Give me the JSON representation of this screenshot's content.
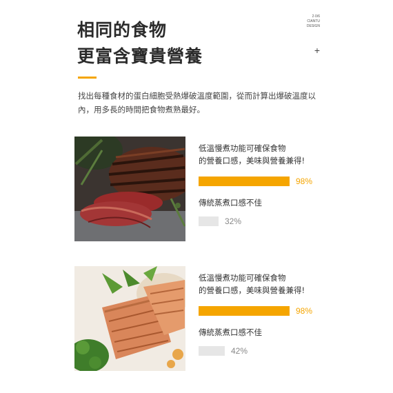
{
  "heading": {
    "line1": "相同的食物",
    "line2": "更富含寶貴營養"
  },
  "brand": {
    "line1": "2·0/6",
    "line2": "CIANTU",
    "line3": "DESIGN",
    "plus": "+"
  },
  "intro": "找出每種食材的蛋白細胞受熱爆破溫度範圍，從而計算出爆破溫度以內，用多長的時間把食物煮熟最好。",
  "colors": {
    "accent": "#f5a500",
    "gray_bar": "#e6e6e6"
  },
  "comparisons": [
    {
      "image": "steak-image",
      "feature_line1": "低溫慢煮功能可確保食物",
      "feature_line2": "的營養口感，美味與營養兼得!",
      "good_pct": "98%",
      "good_value": 0.98,
      "alt_label": "傳統蒸煮口感不佳",
      "bad_pct": "32%",
      "bad_value": 0.32
    },
    {
      "image": "salmon-image",
      "feature_line1": "低溫慢煮功能可確保食物",
      "feature_line2": "的營養口感，美味與營養兼得!",
      "good_pct": "98%",
      "good_value": 0.98,
      "alt_label": "傳統蒸煮口感不佳",
      "bad_pct": "42%",
      "bad_value": 0.42
    }
  ]
}
